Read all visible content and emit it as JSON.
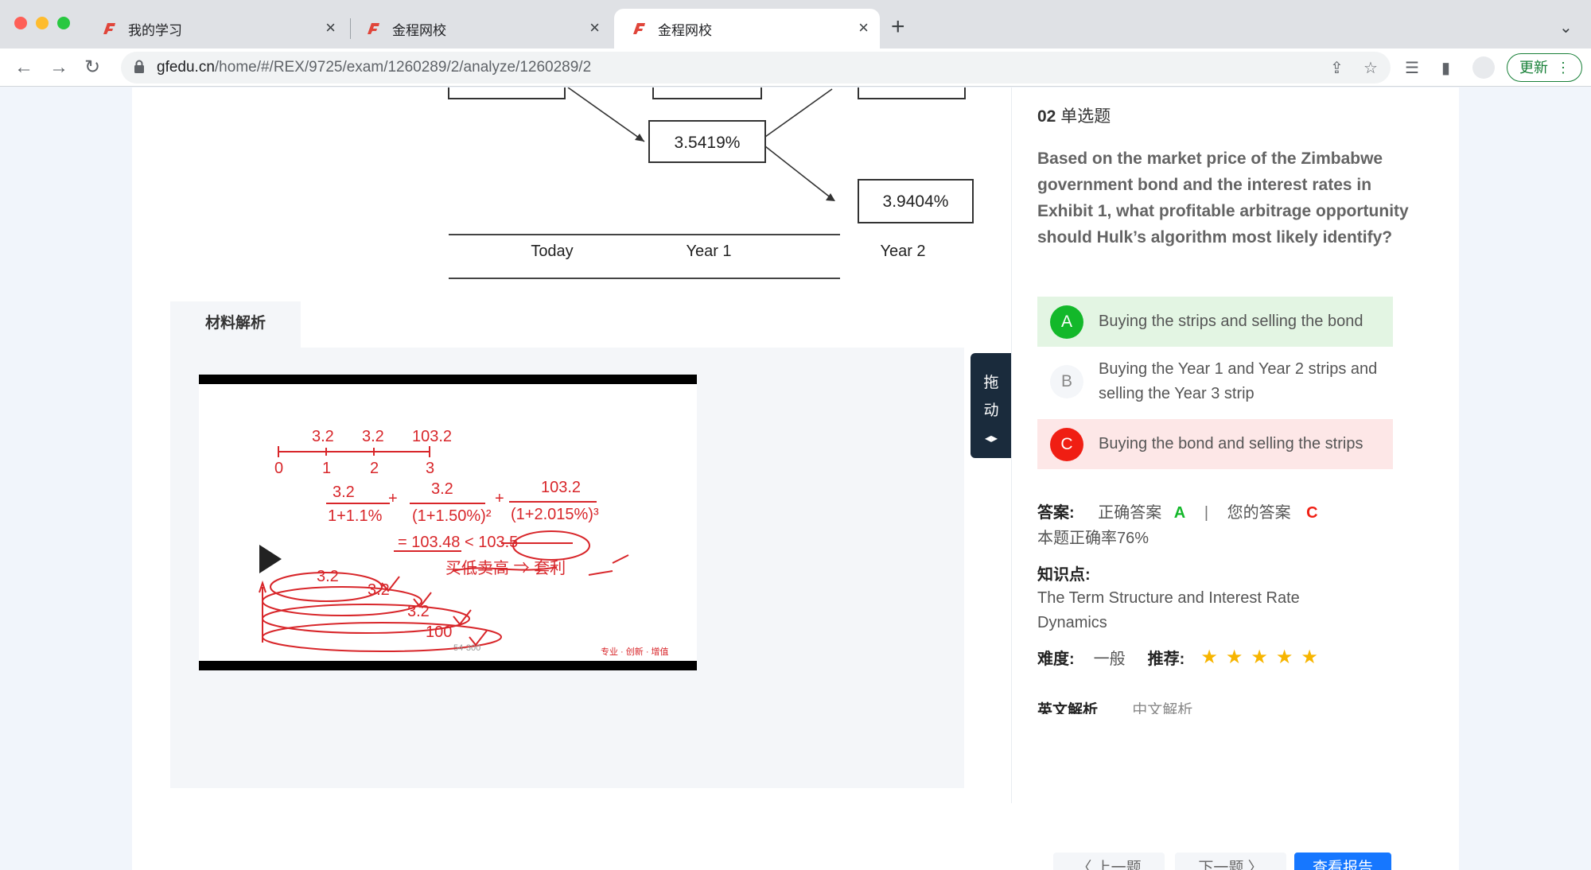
{
  "browser": {
    "tabs": [
      {
        "title": "我的学习"
      },
      {
        "title": "金程网校"
      },
      {
        "title": "金程网校",
        "active": true
      }
    ],
    "url_host": "gfedu.cn",
    "url_path": "/home/#/REX/9725/exam/1260289/2/analyze/1260289/2",
    "update_label": "更新"
  },
  "diagram": {
    "rates": [
      "3.5419%",
      "3.9404%"
    ],
    "timeline": [
      "Today",
      "Year 1",
      "Year 2"
    ]
  },
  "material": {
    "tab_label": "材料解析",
    "drag_label_1": "拖",
    "drag_label_2": "动"
  },
  "question": {
    "number": "02",
    "type": "单选题",
    "text": "Based on the market price of the Zimbabwe government bond and the interest rates in Exhibit 1, what profitable arbitrage opportunity should Hulk’s algorithm most likely identify?",
    "options": [
      {
        "letter": "A",
        "text": "Buying the strips and selling the bond",
        "state": "correct"
      },
      {
        "letter": "B",
        "text": "Buying the Year 1 and Year 2 strips and selling the Year 3 strip",
        "state": "neutral"
      },
      {
        "letter": "C",
        "text": "Buying the bond and selling the strips",
        "state": "wrong"
      }
    ]
  },
  "answer": {
    "label": "答案:",
    "correct_label": "正确答案",
    "correct_value": "A",
    "separator": "|",
    "yours_label": "您的答案",
    "yours_value": "C",
    "rate_text": "本题正确率76%"
  },
  "knowledge": {
    "label": "知识点:",
    "text": "The Term Structure and Interest Rate Dynamics"
  },
  "difficulty": {
    "label": "难度:",
    "value": "一般",
    "recommend_label": "推荐:",
    "stars": 5
  },
  "explanation_tabs": {
    "english": "英文解析",
    "chinese": "中文解析"
  },
  "footer": {
    "prev_label": "〈 上一题",
    "next_label": "下一题 〉",
    "report_label": "查看报告"
  },
  "colors": {
    "correct": "#13b82a",
    "wrong": "#f01e13",
    "primary": "#1677ff",
    "star": "#f7b500"
  }
}
